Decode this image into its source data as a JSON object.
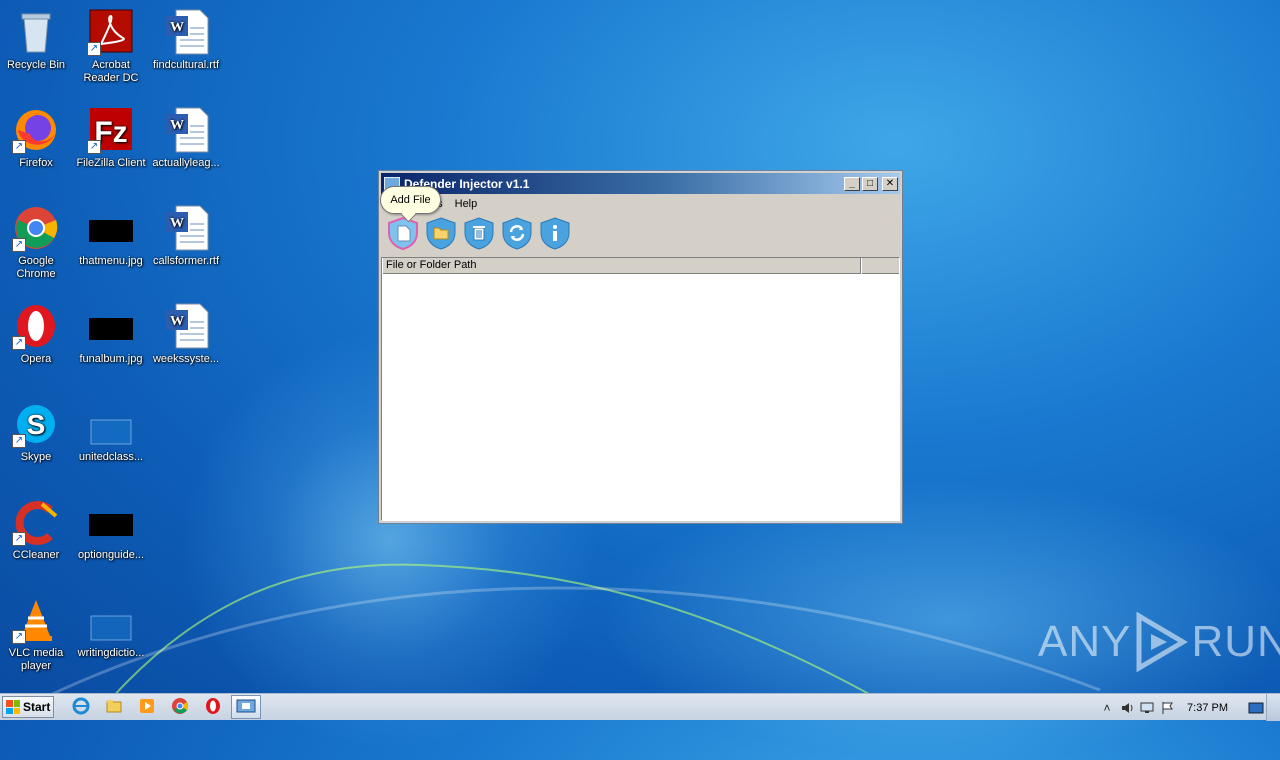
{
  "desktop": {
    "icons": [
      {
        "label": "Recycle Bin"
      },
      {
        "label": "Acrobat Reader DC"
      },
      {
        "label": "findcultural.rtf"
      },
      {
        "label": "Firefox"
      },
      {
        "label": "FileZilla Client"
      },
      {
        "label": "actuallyleag..."
      },
      {
        "label": "Google Chrome"
      },
      {
        "label": "thatmenu.jpg"
      },
      {
        "label": "callsformer.rtf"
      },
      {
        "label": "Opera"
      },
      {
        "label": "funalbum.jpg"
      },
      {
        "label": "weekssyste..."
      },
      {
        "label": "Skype"
      },
      {
        "label": "unitedclass..."
      },
      {
        "label": "CCleaner"
      },
      {
        "label": "optionguide..."
      },
      {
        "label": "VLC media player"
      },
      {
        "label": "writingdictio..."
      }
    ]
  },
  "window": {
    "title": "Defender Injector v1.1",
    "menu": [
      "Options",
      "Help"
    ],
    "menu_visible": [
      "ns",
      "Help"
    ],
    "tooltip": "Add File",
    "toolbar_icons": [
      "add-file-icon",
      "add-folder-icon",
      "delete-icon",
      "refresh-icon",
      "info-icon"
    ],
    "list": {
      "columns": [
        "File or Folder Path",
        ""
      ]
    }
  },
  "taskbar": {
    "start_label": "Start",
    "apps": [
      "internet-explorer-icon",
      "explorer-icon",
      "media-player-icon",
      "chrome-icon",
      "opera-icon",
      "defender-injector-icon"
    ],
    "clock": "7:37 PM"
  },
  "watermark": {
    "left": "ANY",
    "right": "RUN"
  },
  "colors": {
    "accent": "#0a246a",
    "tooltip_bg": "#ffffe1",
    "shield_blue": "#3fa0e0"
  }
}
